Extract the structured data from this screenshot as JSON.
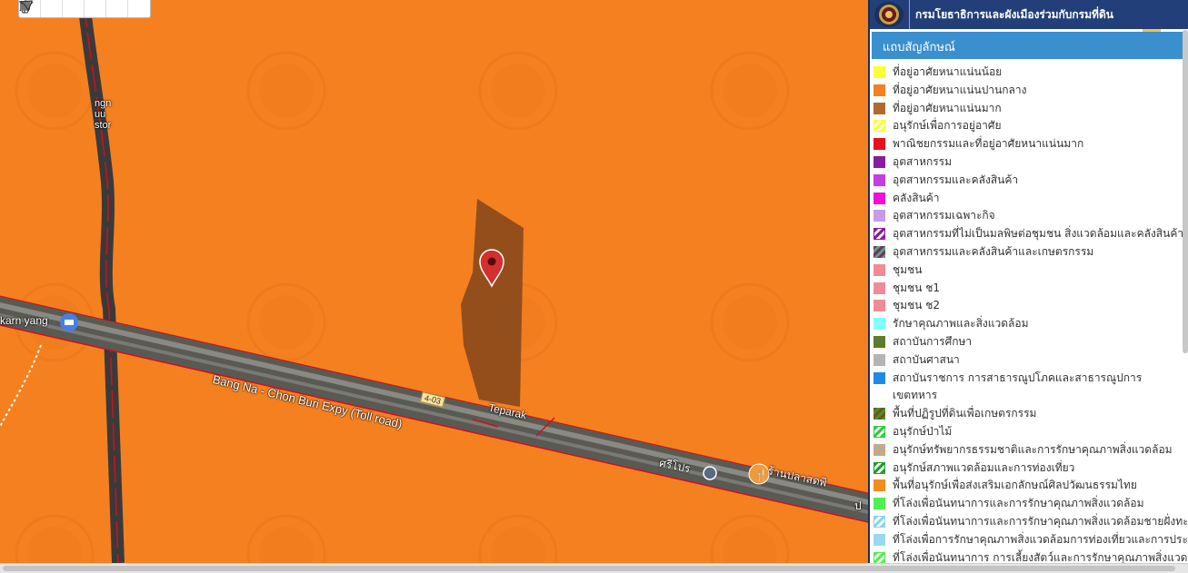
{
  "header": {
    "agency": "กรมโยธาธิการและผังเมืองร่วมกับกรมที่ดิน"
  },
  "toolbar": {
    "tools": [
      "hand-icon",
      "marker-icon",
      "polyline-icon",
      "rectangle-icon",
      "circle-icon",
      "polygon-icon"
    ]
  },
  "map": {
    "road_main": "Bang Na - Chon Buri Expy (Toll road)",
    "road_shield": "4-03",
    "poi_left": "karn yang",
    "poi_tep": "Teparak",
    "poi_fish": "ร้านปลาสดพิ",
    "poi_bl": "ศรีโปร",
    "poi_top": "ngn\nuu\nstor",
    "poi_bottom": "ป",
    "colors": {
      "zone": "#f58020",
      "parcel": "#8a4a1c",
      "pin": "#d32f2f"
    }
  },
  "legend": {
    "title": "แถบสัญลักษณ์",
    "items": [
      {
        "label": "ที่อยู่อาศัยหนาแน่นน้อย",
        "swatch": "#ffff33",
        "pattern": "solid"
      },
      {
        "label": "ที่อยู่อาศัยหนาแน่นปานกลาง",
        "swatch": "#f58020",
        "pattern": "solid"
      },
      {
        "label": "ที่อยู่อาศัยหนาแน่นมาก",
        "swatch": "#b06a2c",
        "pattern": "solid"
      },
      {
        "label": "อนุรักษ์เพื่อการอยู่อาศัย",
        "swatch": "#ffff33",
        "pattern": "hatch"
      },
      {
        "label": "พาณิชยกรรมและที่อยู่อาศัยหนาแน่นมาก",
        "swatch": "#e8101c",
        "pattern": "solid"
      },
      {
        "label": "อุตสาหกรรม",
        "swatch": "#8b1aa0",
        "pattern": "solid"
      },
      {
        "label": "อุตสาหกรรมและคลังสินค้า",
        "swatch": "#c53ddf",
        "pattern": "solid"
      },
      {
        "label": "คลังสินค้า",
        "swatch": "#f010d8",
        "pattern": "solid"
      },
      {
        "label": "อุตสาหกรรมเฉพาะกิจ",
        "swatch": "#c89ae8",
        "pattern": "solid"
      },
      {
        "label": "อุตสาหกรรมที่ไม่เป็นมลพิษต่อชุมชน สิ่งแวดล้อมและคลังสินค้า",
        "swatch": "#8b1aa0",
        "pattern": "hatch"
      },
      {
        "label": "อุตสาหกรรมและคลังสินค้าและเกษตรกรรม",
        "swatch": "#8b1aa0",
        "pattern": "hatch-dual"
      },
      {
        "label": "ชุมชน",
        "swatch": "#f08c96",
        "pattern": "solid"
      },
      {
        "label": "ชุมชน  ช1",
        "swatch": "#f08c96",
        "pattern": "solid"
      },
      {
        "label": "ชุมชน  ช2",
        "swatch": "#f08c96",
        "pattern": "solid"
      },
      {
        "label": "รักษาคุณภาพและสิ่งแวดล้อม",
        "swatch": "#80ffff",
        "pattern": "solid"
      },
      {
        "label": "สถาบันการศึกษา",
        "swatch": "#5f7c28",
        "pattern": "solid"
      },
      {
        "label": "สถาบันศาสนา",
        "swatch": "#b4b4b4",
        "pattern": "solid"
      },
      {
        "label": "สถาบันราชการ การสาธารณูปโภคและสาธารณูปการ",
        "swatch": "#1e8ae6",
        "pattern": "solid"
      },
      {
        "label": "เขตทหาร",
        "swatch": "",
        "pattern": "none"
      },
      {
        "label": "พื้นที่ปฏิรูปที่ดินเพื่อเกษตรกรรม",
        "swatch": "#8a4a1c",
        "pattern": "hatch-dual-green"
      },
      {
        "label": "อนุรักษ์ป่าไม้",
        "swatch": "#2ecc40",
        "pattern": "hatch"
      },
      {
        "label": "อนุรักษ์ทรัพยากรธรรมชาติและการรักษาคุณภาพสิ่งแวดล้อม",
        "swatch": "#f5a040",
        "pattern": "hatch-blue"
      },
      {
        "label": "อนุรักษ์สภาพแวดล้อมและการท่องเที่ยว",
        "swatch": "#1e9e28",
        "pattern": "hatch"
      },
      {
        "label": "พื้นที่อนุรักษ์เพื่อส่งเสริมเอกลักษณ์ศิลปวัฒนธรรมไทย",
        "swatch": "#f58c20",
        "pattern": "solid"
      },
      {
        "label": "ที่โล่งเพื่อนันทนาการและการรักษาคุณภาพสิ่งแวดล้อม",
        "swatch": "#50f050",
        "pattern": "solid"
      },
      {
        "label": "ที่โล่งเพื่อนันทนาการและการรักษาคุณภาพสิ่งแวดล้อมชายฝั่งทะเล",
        "swatch": "#8ad4f0",
        "pattern": "hatch"
      },
      {
        "label": "ที่โล่งเพื่อการรักษาคุณภาพสิ่งแวดล้อมการท่องเที่ยวและการประมง",
        "swatch": "#9ad8f0",
        "pattern": "solid"
      },
      {
        "label": "ที่โล่งเพื่อนันทนาการ การเลี้ยงสัตว์และการรักษาคุณภาพสิ่งแวดล้อม",
        "swatch": "#50f050",
        "pattern": "hatch"
      }
    ]
  }
}
